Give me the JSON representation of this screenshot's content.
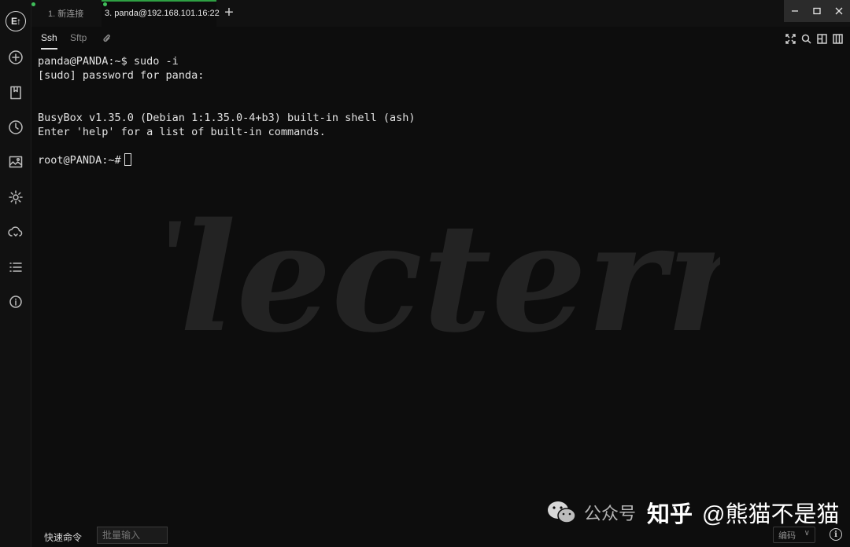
{
  "sidebar": {
    "logo_text": "E↑",
    "icons": [
      "add-session-icon",
      "bookmark-icon",
      "history-icon",
      "image-icon",
      "settings-icon",
      "sync-icon",
      "list-icon",
      "info-icon"
    ]
  },
  "tabs": [
    {
      "label": "1. 新连接",
      "active": false
    },
    {
      "label": "3. panda@192.168.101.16:22",
      "active": true
    }
  ],
  "window_controls": {
    "minimize": "—",
    "maximize": "☐",
    "close": "✕"
  },
  "subtabs": [
    {
      "label": "Ssh",
      "active": true
    },
    {
      "label": "Sftp",
      "active": false
    }
  ],
  "terminal": {
    "lines": [
      "panda@PANDA:~$ sudo -i",
      "[sudo] password for panda:",
      "",
      "",
      "BusyBox v1.35.0 (Debian 1:1.35.0-4+b3) built-in shell (ash)",
      "Enter 'help' for a list of built-in commands.",
      "",
      "root@PANDA:~#"
    ]
  },
  "watermark_text": "Electerm",
  "bottom": {
    "quick_command_label": "快速命令",
    "batch_input_placeholder": "批量输入",
    "encoding_label": "编码",
    "info_label": "i"
  },
  "overlay": {
    "wechat_text": "公众号",
    "zhihu_text": "知乎",
    "author": "@熊猫不是猫"
  },
  "colors": {
    "background": "#0d0d0d",
    "accent_green": "#2ea043",
    "text": "#e2e2e2"
  }
}
